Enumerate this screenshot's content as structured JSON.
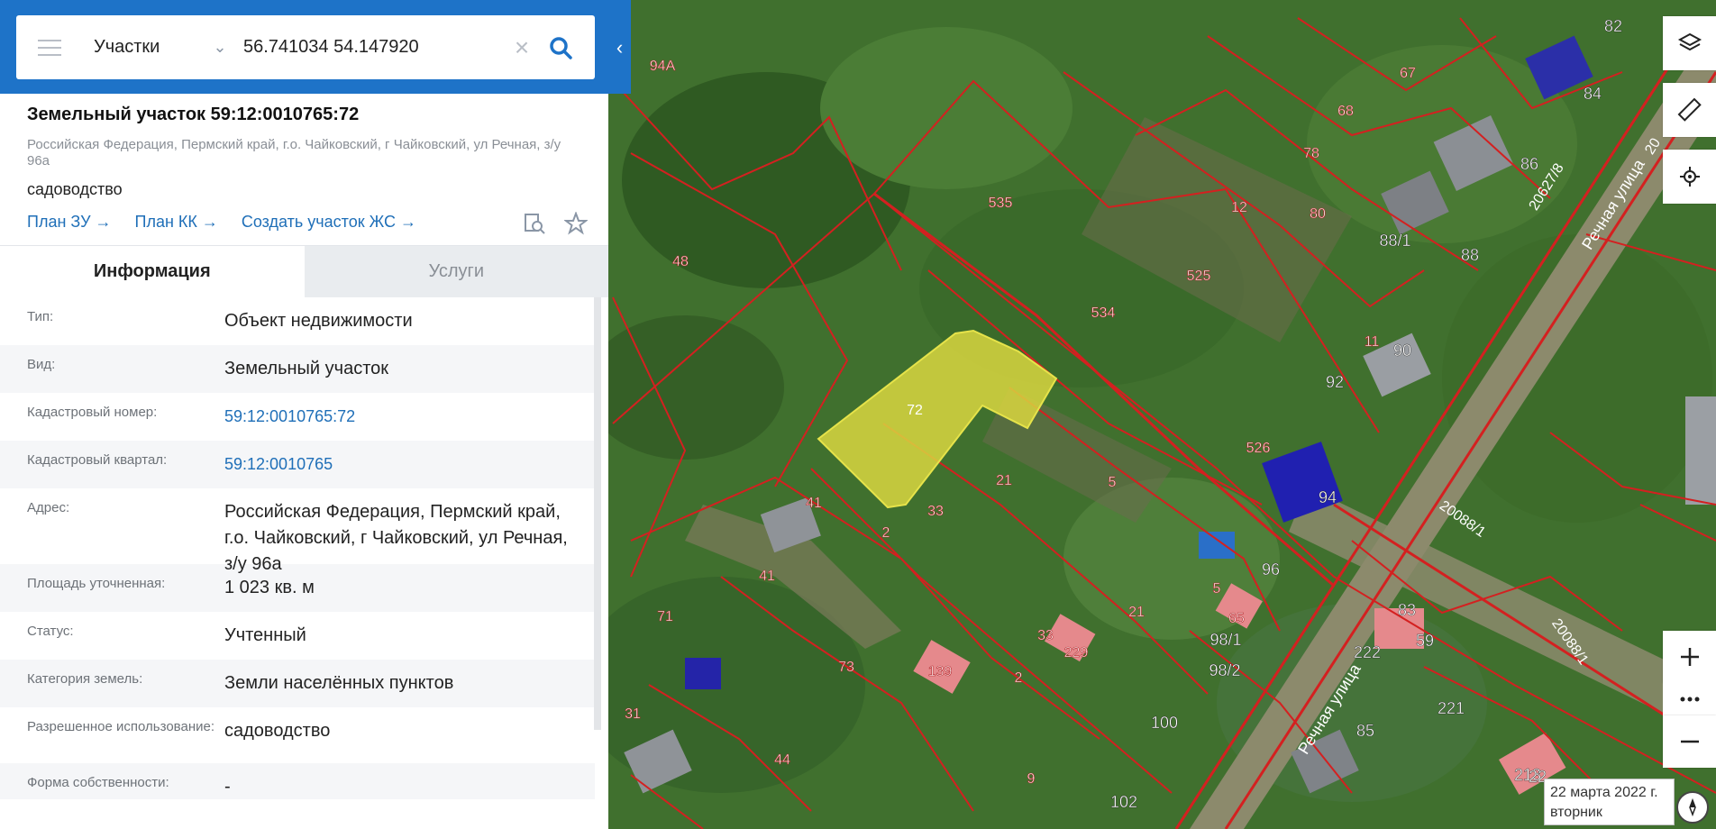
{
  "search": {
    "layer": "Участки",
    "query": "56.741034 54.147920"
  },
  "parcel": {
    "title": "Земельный участок 59:12:0010765:72",
    "address": "Российская Федерация, Пермский край, г.о. Чайковский, г Чайковский, ул Речная, з/у 96а",
    "use": "садоводство",
    "links": [
      "План ЗУ →",
      "План КК →",
      "Создать участок ЖС →"
    ]
  },
  "tabs": [
    "Информация",
    "Услуги"
  ],
  "info_rows": [
    {
      "label": "Тип:",
      "value": "Объект недвижимости"
    },
    {
      "label": "Вид:",
      "value": "Земельный участок"
    },
    {
      "label": "Кадастровый номер:",
      "value": "59:12:0010765:72"
    },
    {
      "label": "Кадастровый квартал:",
      "value": "59:12:0010765"
    },
    {
      "label": "Адрес:",
      "value": "Российская Федерация, Пермский край, г.о. Чайковский, г Чайковский, ул Речная, з/у 96а"
    },
    {
      "label": "Площадь уточненная:",
      "value": "1 023 кв. м"
    },
    {
      "label": "Статус:",
      "value": "Учтенный"
    },
    {
      "label": "Категория земель:",
      "value": "Земли населённых пунктов"
    },
    {
      "label": "Разрешенное использование:",
      "value": "садоводство"
    },
    {
      "label": "Форма собственности:",
      "value": "-"
    }
  ],
  "map": {
    "selected_label": "72",
    "parcel_labels": [
      "94А",
      "67",
      "68",
      "78",
      "80",
      "12",
      "535",
      "48",
      "534",
      "525",
      "11",
      "526",
      "5",
      "21",
      "33",
      "41",
      "41",
      "2",
      "71",
      "73",
      "139",
      "33",
      "229",
      "21",
      "5",
      "65",
      "2",
      "31",
      "44",
      "9",
      "100",
      "102",
      "98/1",
      "98/2",
      "96",
      "94",
      "92",
      "90",
      "88",
      "88/1",
      "86",
      "84",
      "82",
      "83",
      "59",
      "222",
      "221",
      "85",
      "213",
      "22"
    ],
    "street_labels": [
      "Речная улица",
      "Речная улица"
    ],
    "road_labels": [
      "20627/8",
      "20088/1",
      "20088/1",
      "20"
    ],
    "imagery_date": "22 марта 2022 г.",
    "imagery_weekday": "вторник"
  }
}
